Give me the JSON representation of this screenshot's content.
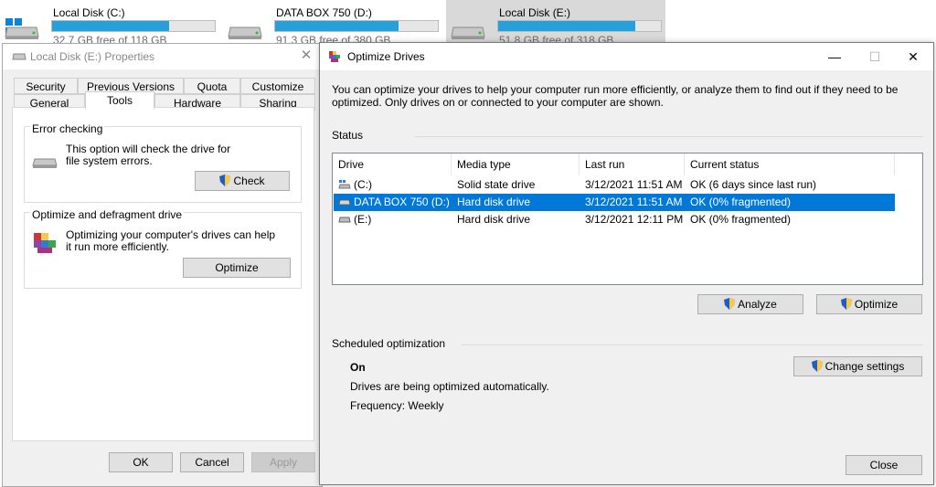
{
  "explorer": {
    "drives": [
      {
        "name": "Local Disk (C:)",
        "free_text": "32.7 GB free of 118 GB",
        "used_fraction": 0.72
      },
      {
        "name": "DATA BOX 750 (D:)",
        "free_text": "91.3 GB free of 380 GB",
        "used_fraction": 0.76
      },
      {
        "name": "Local Disk (E:)",
        "free_text": "51.8 GB free of 318 GB",
        "used_fraction": 0.84
      }
    ]
  },
  "properties": {
    "title": "Local Disk (E:) Properties",
    "tabs_row1": [
      "Security",
      "Previous Versions",
      "Quota",
      "Customize"
    ],
    "tabs_row2": [
      "General",
      "Tools",
      "Hardware",
      "Sharing"
    ],
    "active_tab": "Tools",
    "error_checking": {
      "title": "Error checking",
      "description": "This option will check the drive for file system errors.",
      "button": "Check"
    },
    "optimize": {
      "title": "Optimize and defragment drive",
      "description": "Optimizing your computer's drives can help it run more efficiently.",
      "button": "Optimize"
    },
    "buttons": {
      "ok": "OK",
      "cancel": "Cancel",
      "apply": "Apply"
    }
  },
  "optimize_window": {
    "title": "Optimize Drives",
    "controls": {
      "minimize": "—",
      "maximize": "☐",
      "close": "✕"
    },
    "description": "You can optimize your drives to help your computer run more efficiently, or analyze them to find out if they need to be optimized. Only drives on or connected to your computer are shown.",
    "status_label": "Status",
    "columns": [
      "Drive",
      "Media type",
      "Last run",
      "Current status"
    ],
    "rows": [
      {
        "drive": "(C:)",
        "media": "Solid state drive",
        "last_run": "3/12/2021 11:51 AM",
        "status": "OK (6 days since last run)",
        "icon": "ssd-drive-icon",
        "selected": false
      },
      {
        "drive": "DATA BOX 750 (D:)",
        "media": "Hard disk drive",
        "last_run": "3/12/2021 11:51 AM",
        "status": "OK (0% fragmented)",
        "icon": "hdd-drive-icon",
        "selected": true
      },
      {
        "drive": "(E:)",
        "media": "Hard disk drive",
        "last_run": "3/12/2021 12:11 PM",
        "status": "OK (0% fragmented)",
        "icon": "hdd-drive-icon",
        "selected": false
      }
    ],
    "analyze_button": "Analyze",
    "optimize_button": "Optimize",
    "scheduled": {
      "label": "Scheduled optimization",
      "state": "On",
      "description": "Drives are being optimized automatically.",
      "frequency": "Frequency: Weekly",
      "change_button": "Change settings"
    },
    "close_button": "Close"
  },
  "colors": {
    "accent": "#0078d7",
    "bar_fill": "#26a0da"
  }
}
